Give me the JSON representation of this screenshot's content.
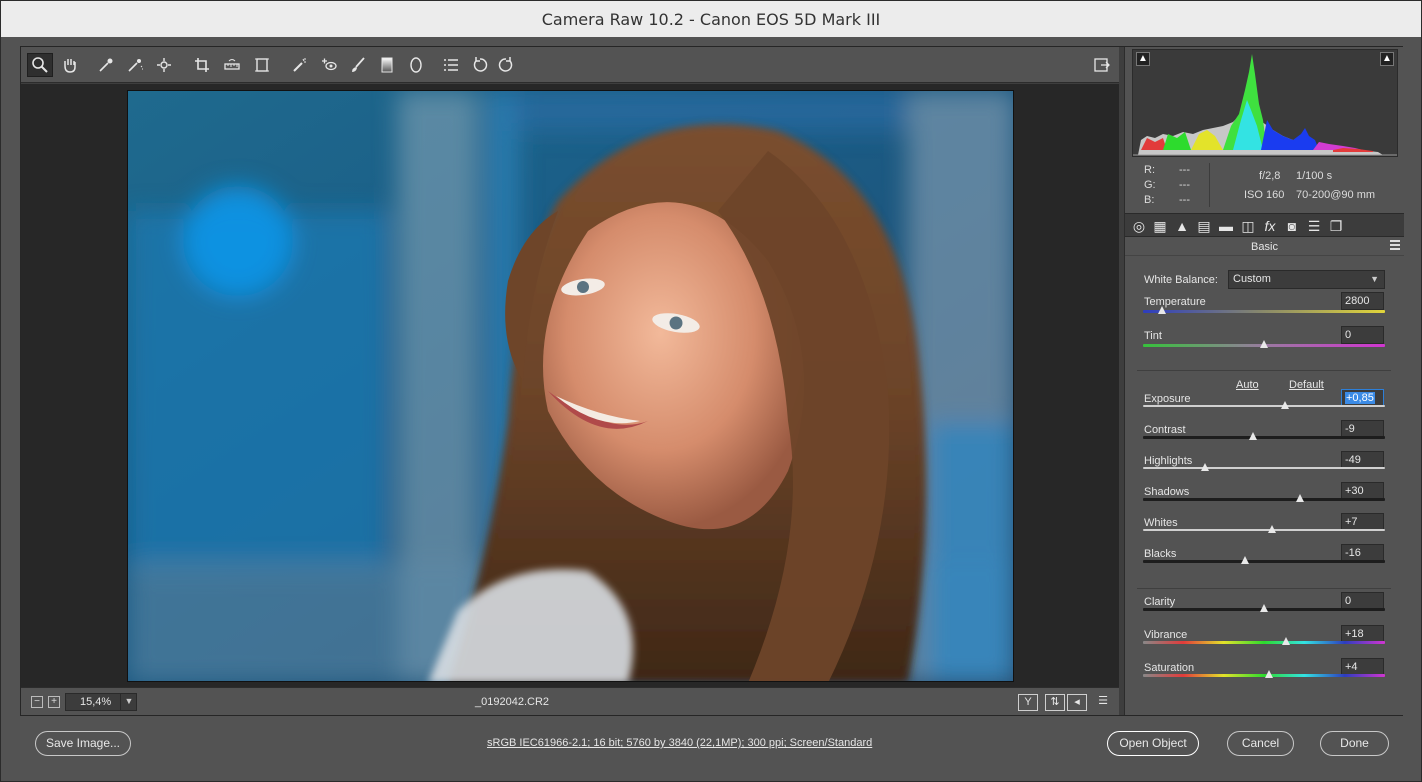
{
  "window": {
    "title": "Camera Raw 10.2  -  Canon EOS 5D Mark III"
  },
  "toolbar": {
    "tools": [
      {
        "name": "zoom-tool",
        "icon": "magnifier-icon"
      },
      {
        "name": "hand-tool",
        "icon": "hand-icon"
      },
      {
        "name": "white-balance-tool",
        "icon": "eyedropper-icon"
      },
      {
        "name": "color-sampler-tool",
        "icon": "color-sampler-icon"
      },
      {
        "name": "targeted-adjustment-tool",
        "icon": "target-adjust-icon"
      },
      {
        "name": "crop-tool",
        "icon": "crop-icon"
      },
      {
        "name": "straighten-tool",
        "icon": "straighten-icon"
      },
      {
        "name": "transform-tool",
        "icon": "transform-icon"
      },
      {
        "name": "spot-removal-tool",
        "icon": "spot-removal-icon"
      },
      {
        "name": "red-eye-tool",
        "icon": "red-eye-icon"
      },
      {
        "name": "adjustment-brush-tool",
        "icon": "brush-icon"
      },
      {
        "name": "graduated-filter-tool",
        "icon": "graduated-filter-icon"
      },
      {
        "name": "radial-filter-tool",
        "icon": "radial-filter-icon"
      },
      {
        "name": "preferences-tool",
        "icon": "list-icon"
      },
      {
        "name": "rotate-left-tool",
        "icon": "rotate-ccw-icon"
      },
      {
        "name": "rotate-right-tool",
        "icon": "rotate-cw-icon"
      }
    ]
  },
  "preview": {
    "zoom": "15,4%",
    "filename": "_0192042.CR2",
    "view_buttons": [
      "Y",
      "",
      "",
      ""
    ]
  },
  "info": {
    "r_label": "R:",
    "g_label": "G:",
    "b_label": "B:",
    "r": "---",
    "g": "---",
    "b": "---",
    "aperture": "f/2,8",
    "shutter": "1/100 s",
    "iso": "ISO 160",
    "lens": "70-200@90 mm"
  },
  "panel": {
    "title": "Basic",
    "white_balance": {
      "label": "White Balance:",
      "value": "Custom"
    },
    "auto_link": "Auto",
    "default_link": "Default",
    "sliders": [
      {
        "label": "Temperature",
        "value": "2800",
        "fraction": 0.08,
        "track": "temperature"
      },
      {
        "label": "Tint",
        "value": "0",
        "fraction": 0.5,
        "track": "tint"
      },
      {
        "label": "Exposure",
        "value": "+0,85",
        "fraction": 0.585,
        "track": "gray",
        "selected": true
      },
      {
        "label": "Contrast",
        "value": "-9",
        "fraction": 0.455,
        "track": "dark"
      },
      {
        "label": "Highlights",
        "value": "-49",
        "fraction": 0.255,
        "track": "gray"
      },
      {
        "label": "Shadows",
        "value": "+30",
        "fraction": 0.65,
        "track": "dark"
      },
      {
        "label": "Whites",
        "value": "+7",
        "fraction": 0.535,
        "track": "gray"
      },
      {
        "label": "Blacks",
        "value": "-16",
        "fraction": 0.42,
        "track": "dark"
      },
      {
        "label": "Clarity",
        "value": "0",
        "fraction": 0.5,
        "track": "dark"
      },
      {
        "label": "Vibrance",
        "value": "+18",
        "fraction": 0.59,
        "track": "spectrum"
      },
      {
        "label": "Saturation",
        "value": "+4",
        "fraction": 0.52,
        "track": "spectrum"
      }
    ]
  },
  "footer": {
    "save_image": "Save Image...",
    "workflow": "sRGB IEC61966-2.1; 16 bit; 5760 by 3840 (22,1MP); 300 ppi; Screen/Standard",
    "open_object": "Open Object",
    "cancel": "Cancel",
    "done": "Done"
  },
  "colors": {
    "panel_bg": "#535353",
    "preview_bg": "#272727",
    "selection": "#3b8be6"
  }
}
